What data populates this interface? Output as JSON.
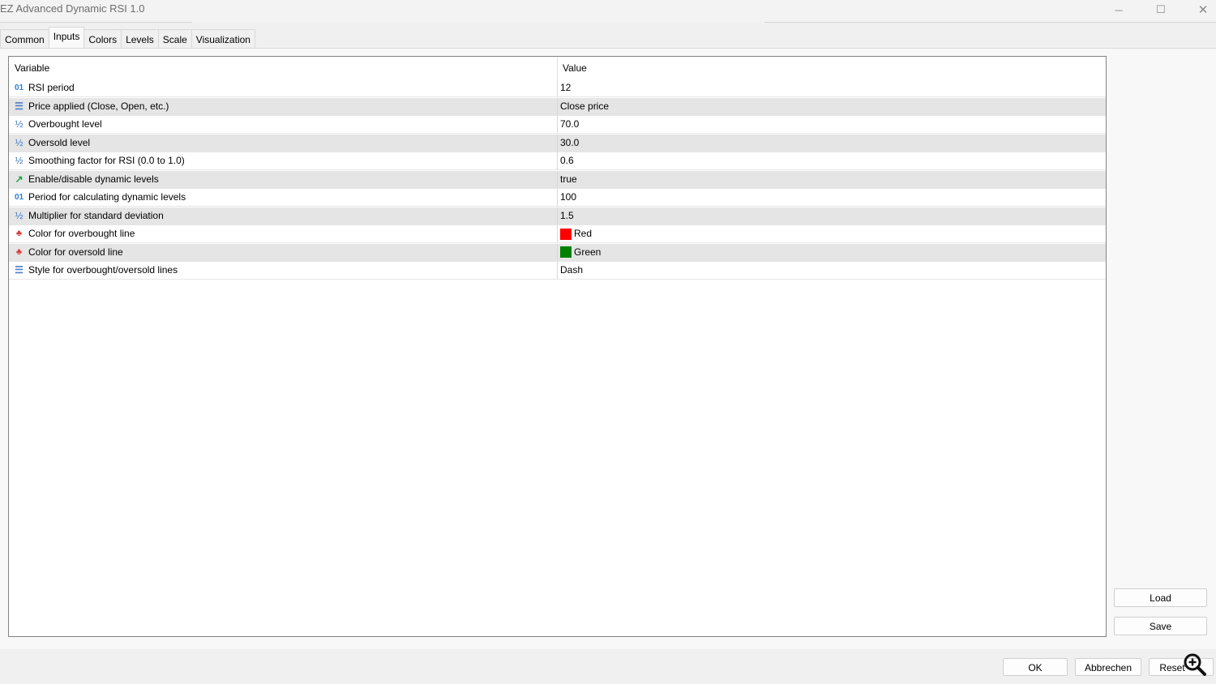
{
  "window": {
    "title": "EZ Advanced Dynamic RSI 1.0",
    "minimize": "─",
    "maximize": "☐",
    "close": "✕"
  },
  "tabs": [
    {
      "label": "Common"
    },
    {
      "label": "Inputs",
      "active": true
    },
    {
      "label": "Colors"
    },
    {
      "label": "Levels"
    },
    {
      "label": "Scale"
    },
    {
      "label": "Visualization"
    }
  ],
  "table": {
    "headers": {
      "variable": "Variable",
      "value": "Value"
    },
    "rows": [
      {
        "icon": "integer-icon",
        "glyph": "01",
        "type": "int",
        "variable": "RSI period",
        "value": "12"
      },
      {
        "icon": "enum-icon",
        "glyph": "☰",
        "type": "enum",
        "variable": "Price applied (Close, Open, etc.)",
        "value": "Close price"
      },
      {
        "icon": "double-icon",
        "glyph": "½",
        "type": "dbl",
        "variable": "Overbought level",
        "value": "70.0"
      },
      {
        "icon": "double-icon",
        "glyph": "½",
        "type": "dbl",
        "variable": "Oversold level",
        "value": "30.0"
      },
      {
        "icon": "double-icon",
        "glyph": "½",
        "type": "dbl",
        "variable": "Smoothing factor for RSI (0.0 to 1.0)",
        "value": "0.6"
      },
      {
        "icon": "bool-icon",
        "glyph": "↗",
        "type": "bool",
        "variable": "Enable/disable dynamic levels",
        "value": "true"
      },
      {
        "icon": "integer-icon",
        "glyph": "01",
        "type": "int",
        "variable": "Period for calculating dynamic levels",
        "value": "100"
      },
      {
        "icon": "double-icon",
        "glyph": "½",
        "type": "dbl",
        "variable": "Multiplier for standard deviation",
        "value": "1.5"
      },
      {
        "icon": "color-icon",
        "glyph": "♣",
        "type": "col",
        "variable": "Color for overbought line",
        "value": "Red",
        "swatch": "#ff0000"
      },
      {
        "icon": "color-icon",
        "glyph": "♣",
        "type": "col",
        "variable": "Color for oversold line",
        "value": "Green",
        "swatch": "#008000"
      },
      {
        "icon": "enum-icon",
        "glyph": "☰",
        "type": "enum",
        "variable": "Style for overbought/oversold lines",
        "value": "Dash"
      }
    ]
  },
  "side_buttons": {
    "load": "Load",
    "save": "Save"
  },
  "footer_buttons": {
    "ok": "OK",
    "cancel": "Abbrechen",
    "reset": "Reset"
  }
}
